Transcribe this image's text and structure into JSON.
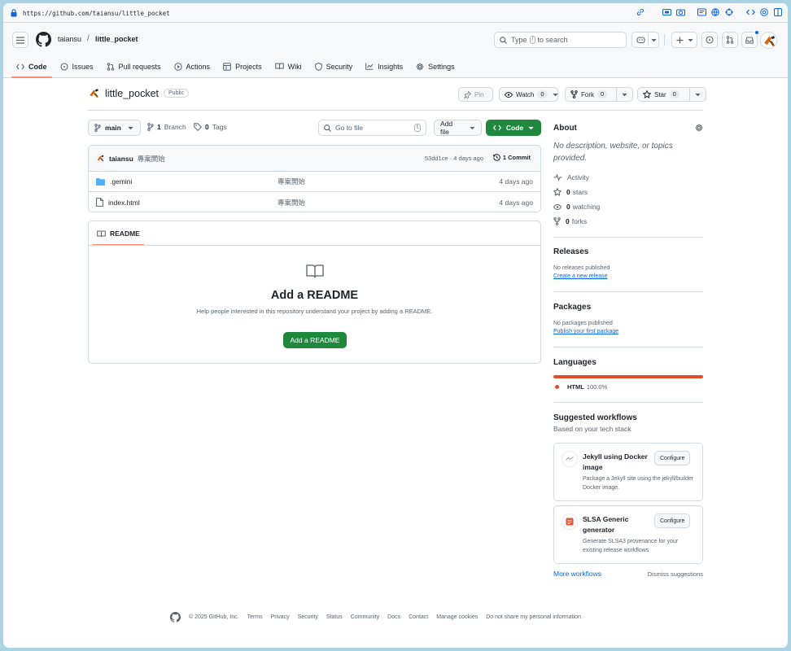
{
  "browser": {
    "url": "https://github.com/taiansu/little_pocket"
  },
  "header": {
    "owner": "taiansu",
    "separator": "/",
    "repo": "little_pocket",
    "search_type": "Type",
    "search_key": "/",
    "search_rest": "to search"
  },
  "tabs": [
    {
      "label": "Code",
      "icon": "code-icon"
    },
    {
      "label": "Issues",
      "icon": "issue-icon"
    },
    {
      "label": "Pull requests",
      "icon": "pull-request-icon"
    },
    {
      "label": "Actions",
      "icon": "play-icon"
    },
    {
      "label": "Projects",
      "icon": "table-icon"
    },
    {
      "label": "Wiki",
      "icon": "book-icon"
    },
    {
      "label": "Security",
      "icon": "shield-icon"
    },
    {
      "label": "Insights",
      "icon": "graph-icon"
    },
    {
      "label": "Settings",
      "icon": "gear-icon"
    }
  ],
  "repo": {
    "name": "little_pocket",
    "visibility": "Public",
    "pin": "Pin",
    "watch": "Watch",
    "watch_count": "0",
    "fork": "Fork",
    "fork_count": "0",
    "star": "Star",
    "star_count": "0"
  },
  "controls": {
    "branch": "main",
    "branch_count": "1",
    "branch_label": "Branch",
    "tag_count": "0",
    "tag_label": "Tags",
    "goto_placeholder": "Go to file",
    "goto_key": "t",
    "add_file": "Add file",
    "code": "Code"
  },
  "commit": {
    "author": "taiansu",
    "message": "專案開始",
    "hash_time": "53dd1ce · 4 days ago",
    "count": "1 Commit"
  },
  "files": [
    {
      "name": ".gemini",
      "type": "folder",
      "message": "專案開始",
      "date": "4 days ago"
    },
    {
      "name": "index.html",
      "type": "file",
      "message": "專案開始",
      "date": "4 days ago"
    }
  ],
  "readme": {
    "tab": "README",
    "title": "Add a README",
    "subtitle": "Help people interested in this repository understand your project by adding a README.",
    "button": "Add a README"
  },
  "about": {
    "title": "About",
    "description": "No description, website, or topics provided.",
    "activity": "Activity",
    "stars_count": "0",
    "stars": "stars",
    "watching_count": "0",
    "watching": "watching",
    "forks_count": "0",
    "forks": "forks"
  },
  "releases": {
    "title": "Releases",
    "none": "No releases published",
    "link": "Create a new release"
  },
  "packages": {
    "title": "Packages",
    "none": "No packages published",
    "link": "Publish your first package"
  },
  "languages": {
    "title": "Languages",
    "name": "HTML",
    "percent": "100.0%",
    "color": "#e34c26"
  },
  "workflows": {
    "title": "Suggested workflows",
    "subtitle": "Based on your tech stack",
    "items": [
      {
        "name": "Jekyll using Docker image",
        "desc": "Package a Jekyll site using the jekyll/builder Docker image.",
        "button": "Configure"
      },
      {
        "name": "SLSA Generic generator",
        "desc": "Generate SLSA3 provenance for your existing release workflows",
        "button": "Configure"
      }
    ],
    "more": "More workflows",
    "dismiss": "Dismiss suggestions"
  },
  "footer": {
    "copyright": "© 2025 GitHub, Inc.",
    "links": [
      "Terms",
      "Privacy",
      "Security",
      "Status",
      "Community",
      "Docs",
      "Contact",
      "Manage cookies",
      "Do not share my personal information"
    ]
  },
  "colors": {
    "accent_green": "#1f883d",
    "tab_underline": "#fd8c73",
    "link_blue": "#0969da"
  }
}
